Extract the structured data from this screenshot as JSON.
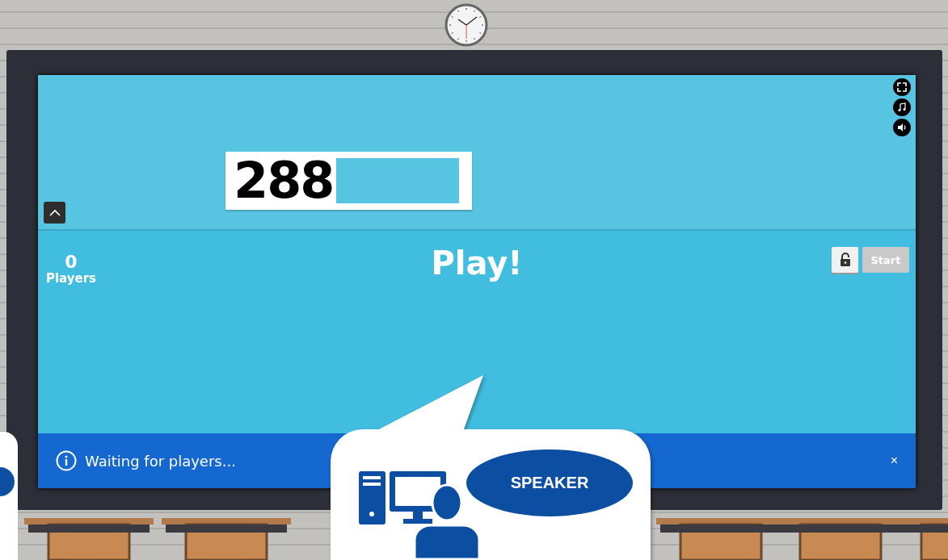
{
  "game": {
    "code": "288",
    "players_count": "0",
    "players_label": "Players",
    "title": "Play!",
    "lock": {
      "locked": false
    },
    "start_button": {
      "label": "Start",
      "disabled": true
    }
  },
  "banner": {
    "message": "Waiting for players...",
    "close": "×"
  },
  "callout": {
    "label": "SPEAKER"
  }
}
